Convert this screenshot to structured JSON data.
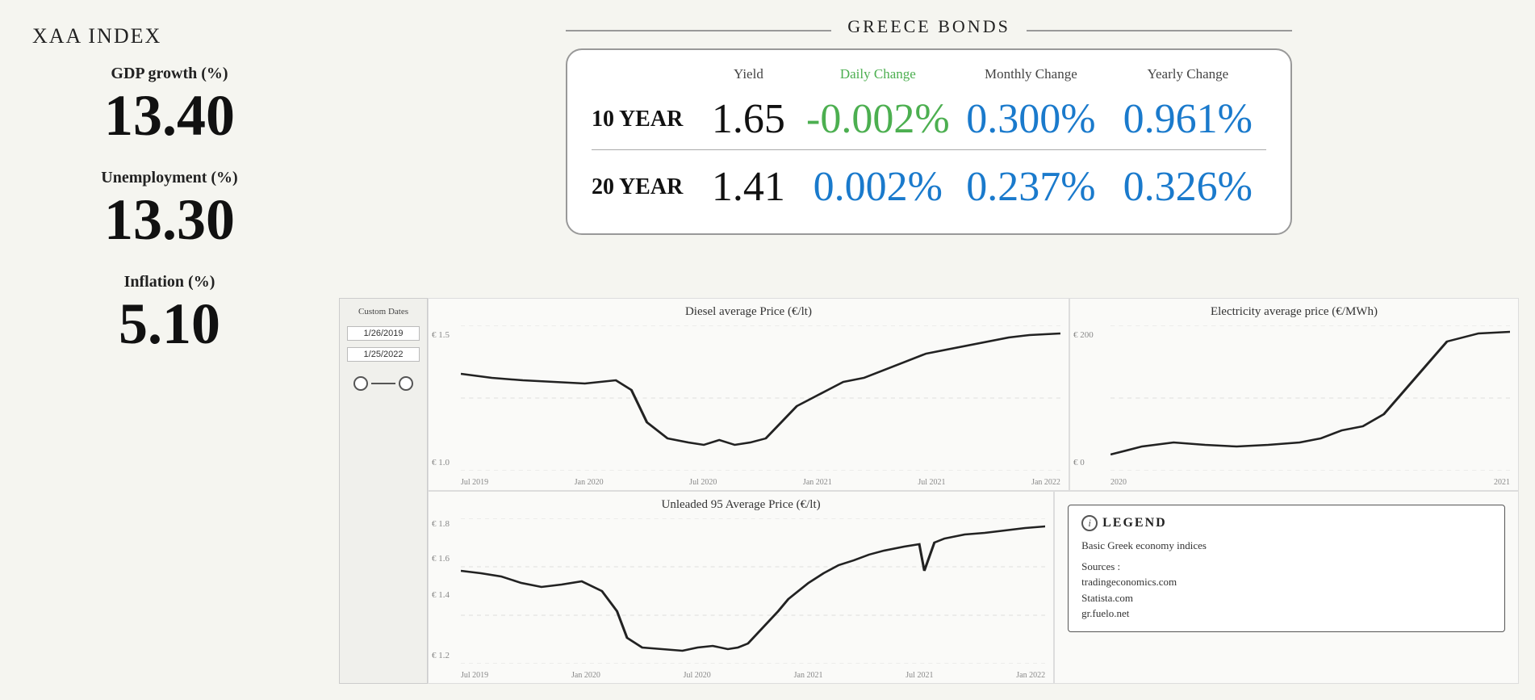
{
  "header": {
    "xaa_title": "XAA INDEX",
    "bonds_title": "GREECE BONDS"
  },
  "bonds": {
    "columns": {
      "yield": "Yield",
      "daily_change": "Daily Change",
      "monthly_change": "Monthly Change",
      "yearly_change": "Yearly Change"
    },
    "rows": [
      {
        "tenor": "10 YEAR",
        "yield": "1.65",
        "daily_change": "-0.002%",
        "daily_color": "green",
        "monthly_change": "0.300%",
        "yearly_change": "0.961%"
      },
      {
        "tenor": "20 YEAR",
        "yield": "1.41",
        "daily_change": "0.002%",
        "daily_color": "blue",
        "monthly_change": "0.237%",
        "yearly_change": "0.326%"
      }
    ]
  },
  "indicators": [
    {
      "label": "GDP growth (%)",
      "value": "13.40"
    },
    {
      "label": "Unemployment (%)",
      "value": "13.30"
    },
    {
      "label": "Inflation (%)",
      "value": "5.10"
    }
  ],
  "date_panel": {
    "title": "Custom Dates",
    "date1": "1/26/2019",
    "date2": "1/25/2022"
  },
  "charts": {
    "diesel": {
      "title": "Diesel average Price (€/lt)",
      "y_min": "€ 1.0",
      "y_mid": "€ 1.5",
      "x_labels": [
        "Jul 2019",
        "Jan 2020",
        "Jul 2020",
        "Jan 2021",
        "Jul 2021",
        "Jan 2022"
      ]
    },
    "electricity": {
      "title": "Electricity average price (€/MWh)",
      "y_min": "€ 0",
      "y_max": "€ 200",
      "x_labels": [
        "2020",
        "2021"
      ]
    },
    "unleaded": {
      "title": "Unleaded 95 Average Price (€/lt)",
      "y_labels": [
        "€ 1.2",
        "€ 1.4",
        "€ 1.6",
        "€ 1.8"
      ],
      "x_labels": [
        "Jul 2019",
        "Jan 2020",
        "Jul 2020",
        "Jan 2021",
        "Jul 2021",
        "Jan 2022"
      ]
    }
  },
  "legend": {
    "title": "LEGEND",
    "description": "Basic Greek economy indices",
    "sources_label": "Sources :",
    "sources": [
      "tradingeconomics.com",
      "Statista.com",
      "gr.fuelo.net"
    ]
  }
}
